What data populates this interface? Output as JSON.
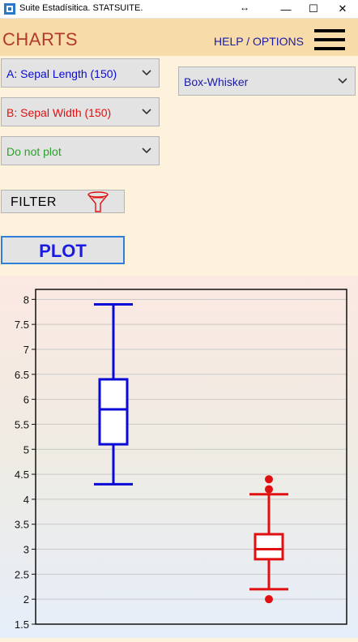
{
  "window": {
    "title": "Suite Estadísitica. STATSUITE.",
    "resize_glyph": "↔",
    "minimize_glyph": "—",
    "maximize_glyph": "☐",
    "close_glyph": "✕"
  },
  "header": {
    "title": "CHARTS",
    "help_label": "HELP / OPTIONS",
    "menu_icon": "hamburger-menu-icon"
  },
  "controls": {
    "var_a": "A: Sepal Length (150)",
    "var_b": "B: Sepal Width (150)",
    "var_c": "Do not plot",
    "chart_type": "Box-Whisker",
    "filter_label": "FILTER",
    "plot_label": "PLOT"
  },
  "colors": {
    "series_a": "#0a0ad6",
    "series_b": "#e01010",
    "series_c": "#2ca02c",
    "chart_type_text": "#1a1aa6",
    "title": "#b33a2b"
  },
  "chart_data": {
    "type": "box",
    "ylim": [
      1.5,
      8.2
    ],
    "yticks": [
      "1.5",
      "2",
      "2.5",
      "3",
      "3.5",
      "4",
      "4.5",
      "5",
      "5.5",
      "6",
      "6.5",
      "7",
      "7.5",
      "8"
    ],
    "grid": true,
    "series": [
      {
        "min": 4.3,
        "q1": 5.1,
        "median": 5.8,
        "q3": 6.4,
        "max": 7.9,
        "outliers": []
      },
      {
        "min": 2.2,
        "q1": 2.8,
        "median": 3.0,
        "q3": 3.3,
        "max": 4.1,
        "outliers": [
          4.4,
          4.2,
          2.0
        ]
      }
    ]
  }
}
